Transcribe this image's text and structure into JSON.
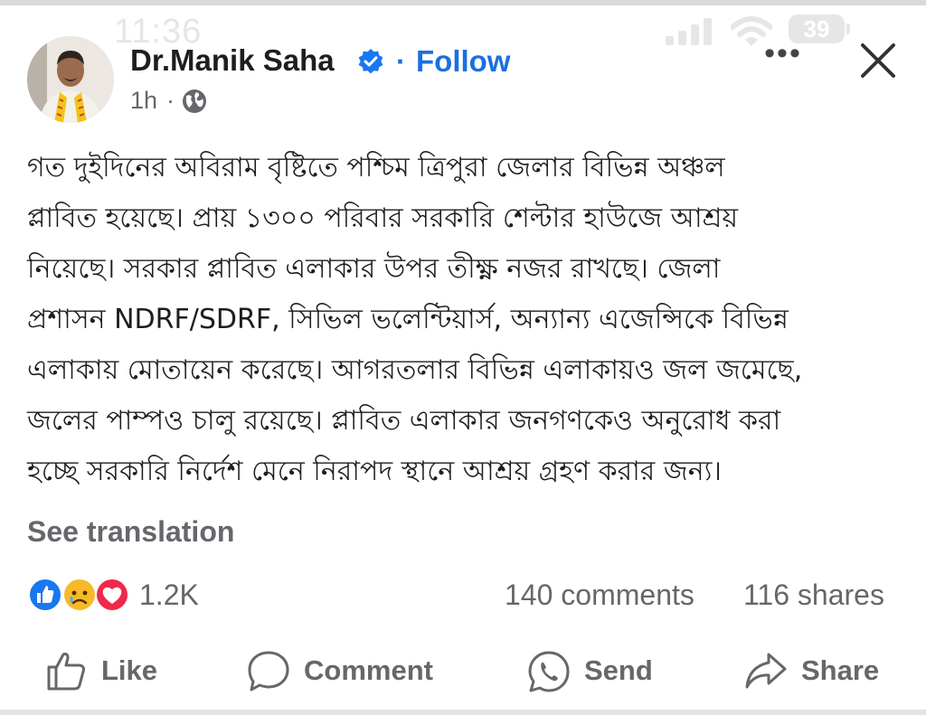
{
  "status_bar": {
    "time": "11:36",
    "battery_level": "39"
  },
  "post": {
    "author": "Dr.Manik Saha",
    "follow_separator": "·",
    "follow_label": "Follow",
    "time_ago": "1h",
    "time_separator": "·",
    "privacy_icon": "globe-icon",
    "more_label": "•••",
    "body_lines": [
      "গত দুইদিনের অবিরাম বৃষ্টিতে পশ্চিম ত্রিপুরা জেলার বিভিন্ন অঞ্চল",
      "প্লাবিত হয়েছে। প্রায় ১৩০০ পরিবার সরকারি শেল্টার  হাউজে আশ্রয়",
      "নিয়েছে। সরকার প্লাবিত এলাকার উপর তীক্ষ্ণ নজর রাখছে। জেলা",
      "প্রশাসন NDRF/SDRF, সিভিল ভলেন্টিয়ার্স, অন্যান্য এজেন্সিকে বিভিন্ন",
      "এলাকায় মোতায়েন করেছে। আগরতলার বিভিন্ন এলাকায়ও জল জমেছে,",
      "জলের পাম্পও চালু রয়েছে। প্লাবিত এলাকার জনগণকেও অনুরোধ করা",
      "হচ্ছে সরকারি নির্দেশ মেনে নিরাপদ স্থানে আশ্রয় গ্রহণ করার জন্য।"
    ],
    "see_translation": "See translation"
  },
  "engagement": {
    "reactions_count": "1.2K",
    "comments": "140 comments",
    "shares": "116 shares"
  },
  "actions": {
    "like": "Like",
    "comment": "Comment",
    "send": "Send",
    "share": "Share"
  },
  "colors": {
    "accent": "#1b6fe0",
    "like_reaction": "#1877f2",
    "love_reaction": "#f02849",
    "sad_reaction": "#f7b928",
    "text_primary": "#1c1e21",
    "text_secondary": "#65676b"
  }
}
